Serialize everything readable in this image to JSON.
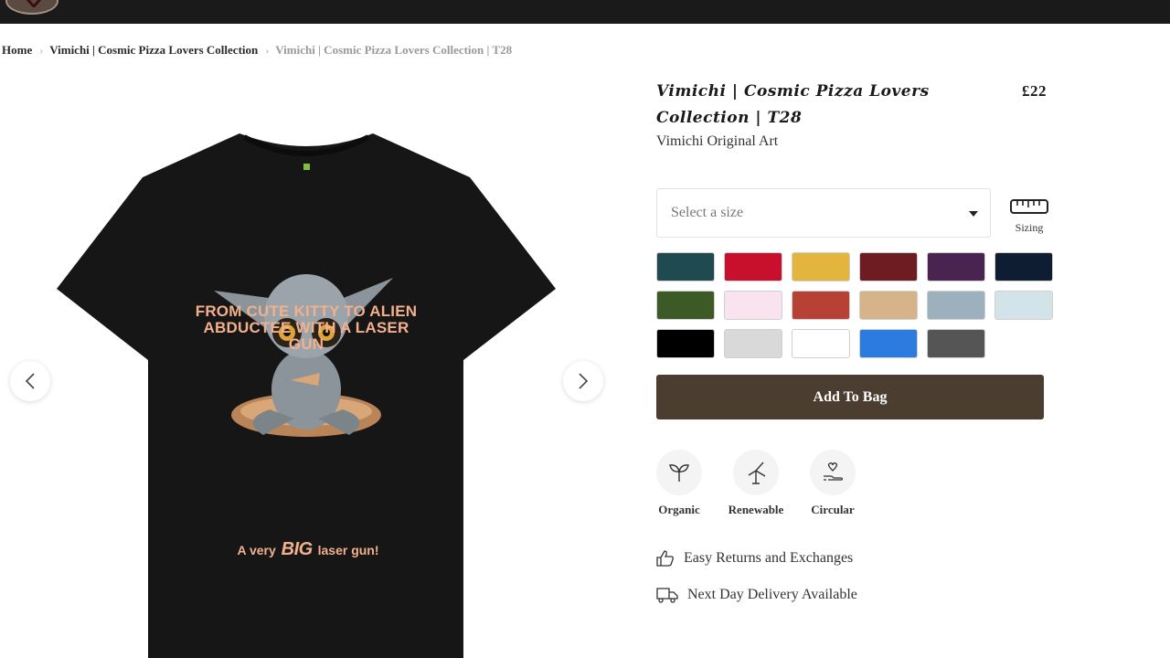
{
  "breadcrumb": [
    {
      "label": "Home"
    },
    {
      "label": "Vimichi | Cosmic Pizza Lovers Collection"
    },
    {
      "label": "Vimichi | Cosmic Pizza Lovers Collection | T28"
    }
  ],
  "product": {
    "title": "Vimichi | Cosmic Pizza Lovers Collection | T28",
    "price": "£22",
    "brand": "Vimichi Original Art"
  },
  "print": {
    "headline": "From cute kitty to alien abductee with a laser gun",
    "footer_pre": "A very",
    "footer_big": "BIG",
    "footer_post": "laser gun!"
  },
  "size_select": {
    "placeholder": "Select a size"
  },
  "sizing_label": "Sizing",
  "colors": [
    "#1f4a4f",
    "#c8102e",
    "#e3b53c",
    "#6e1b22",
    "#4a2450",
    "#0f1d33",
    "#3b5a25",
    "#f9e3ee",
    "#b84135",
    "#d6b48a",
    "#9cb1bd",
    "#d3e3ea",
    "#000000",
    "#d9d9d9",
    "#ffffff",
    "#2c7be0",
    "#555555"
  ],
  "add_to_bag": "Add To Bag",
  "features": [
    {
      "label": "Organic",
      "icon": "sprout-icon"
    },
    {
      "label": "Renewable",
      "icon": "wind-turbine-icon"
    },
    {
      "label": "Circular",
      "icon": "hand-heart-icon"
    }
  ],
  "perks": [
    {
      "label": "Easy Returns and Exchanges",
      "icon": "thumbs-up-icon"
    },
    {
      "label": "Next Day Delivery Available",
      "icon": "delivery-truck-icon"
    }
  ],
  "accent_color": "#4b3d30"
}
